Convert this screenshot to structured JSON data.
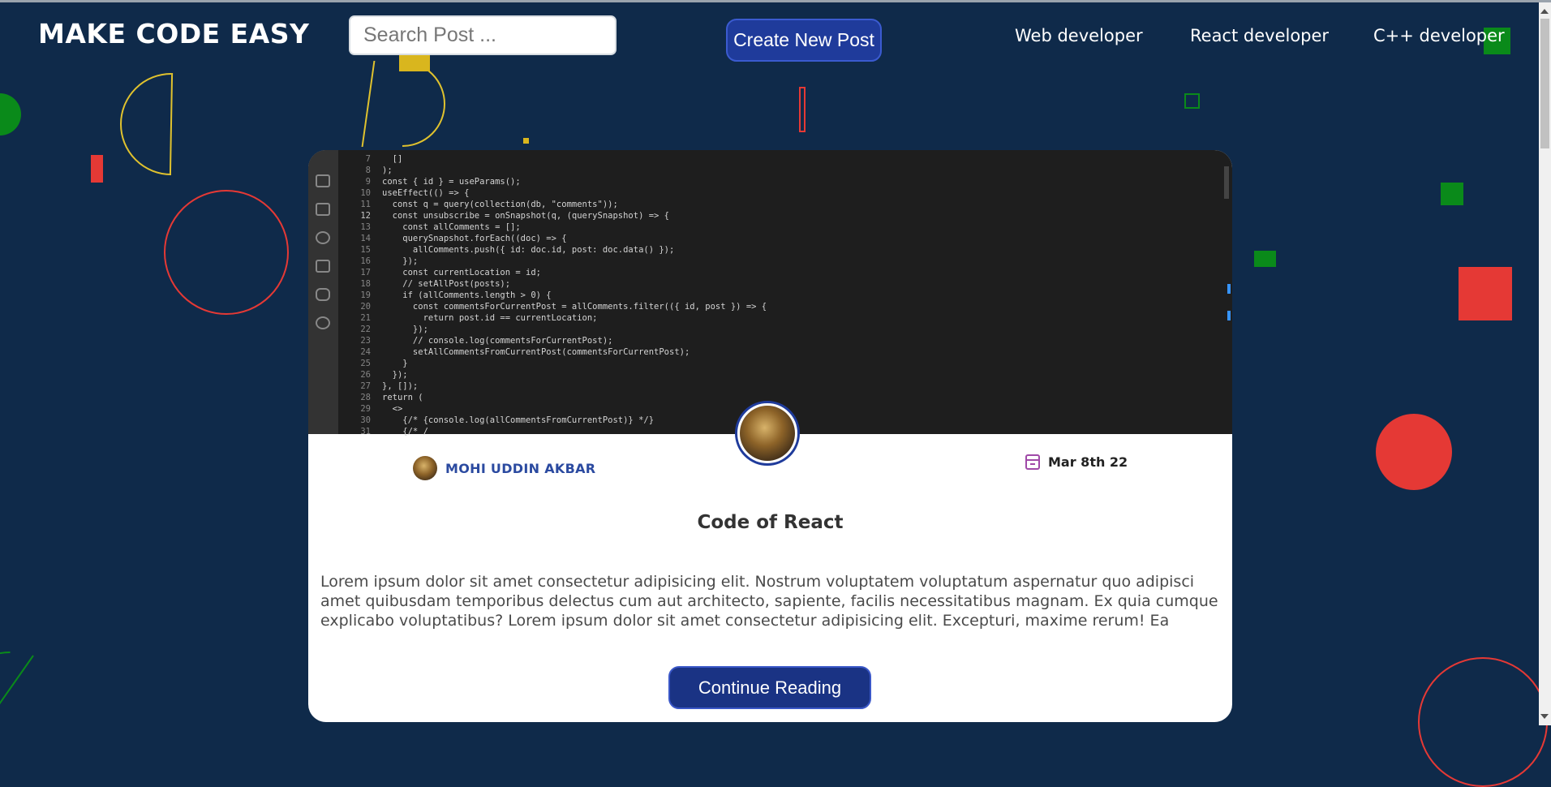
{
  "header": {
    "logo": "MAKE CODE EASY",
    "search_placeholder": "Search Post ...",
    "create_button": "Create New Post",
    "nav": [
      "Web developer",
      "React developer",
      "C++ developer"
    ]
  },
  "post": {
    "author": "MOHI UDDIN AKBAR",
    "date": "Mar 8th 22",
    "title": "Code of React",
    "excerpt": "Lorem ipsum dolor sit amet consectetur adipisicing elit. Nostrum voluptatem voluptatum aspernatur quo adipisci amet quibusdam temporibus delectus cum aut architecto, sapiente, facilis necessitatibus magnam. Ex quia cumque explicabo voluptatibus? Lorem ipsum dolor sit amet consectetur adipisicing elit. Excepturi, maxime rerum! Ea",
    "continue_button": "Continue Reading",
    "code_image": {
      "lines": [
        {
          "n": "7",
          "t": "  []"
        },
        {
          "n": "8",
          "t": ");"
        },
        {
          "n": "9",
          "t": "const { id } = useParams();"
        },
        {
          "n": "10",
          "t": "useEffect(() => {"
        },
        {
          "n": "11",
          "t": "  const q = query(collection(db, \"comments\"));"
        },
        {
          "n": "12",
          "t": "  const unsubscribe = onSnapshot(q, (querySnapshot) => {"
        },
        {
          "n": "13",
          "t": "    const allComments = [];"
        },
        {
          "n": "14",
          "t": "    querySnapshot.forEach((doc) => {"
        },
        {
          "n": "15",
          "t": "      allComments.push({ id: doc.id, post: doc.data() });"
        },
        {
          "n": "16",
          "t": "    });"
        },
        {
          "n": "17",
          "t": "    const currentLocation = id;"
        },
        {
          "n": "18",
          "t": "    // setAllPost(posts);"
        },
        {
          "n": "19",
          "t": "    if (allComments.length > 0) {"
        },
        {
          "n": "20",
          "t": "      const commentsForCurrentPost = allComments.filter(({ id, post }) => {"
        },
        {
          "n": "21",
          "t": "        return post.id == currentLocation;"
        },
        {
          "n": "22",
          "t": "      });"
        },
        {
          "n": "23",
          "t": "      // console.log(commentsForCurrentPost);"
        },
        {
          "n": "24",
          "t": "      setAllCommentsFromCurrentPost(commentsForCurrentPost);"
        },
        {
          "n": "25",
          "t": "    }"
        },
        {
          "n": "26",
          "t": "  });"
        },
        {
          "n": "27",
          "t": "}, []);"
        },
        {
          "n": "28",
          "t": "return ("
        },
        {
          "n": "29",
          "t": "  <>"
        },
        {
          "n": "30",
          "t": "    {/* {console.log(allCommentsFromCurrentPost)} */}"
        },
        {
          "n": "31",
          "t": "    {/* /"
        }
      ],
      "current_line": "12"
    }
  },
  "colors": {
    "background": "#0f2a4a",
    "accent_blue": "#1f3b9b",
    "author_blue": "#2b4aa0",
    "calendar_purple": "#a04aa8"
  }
}
